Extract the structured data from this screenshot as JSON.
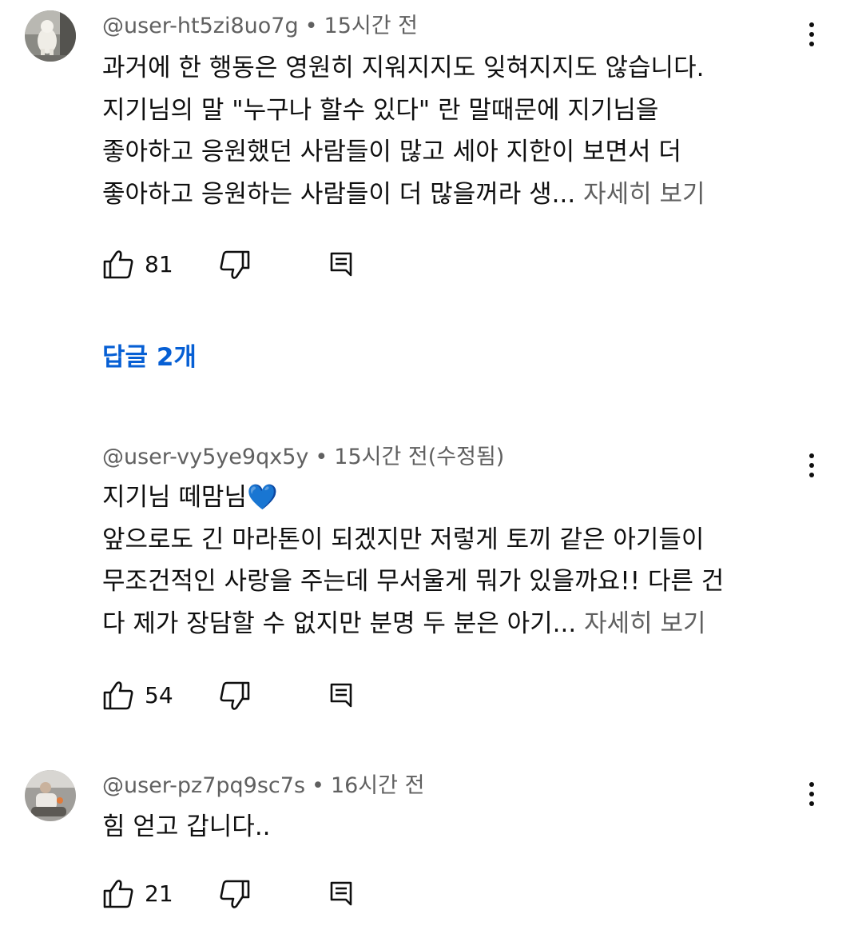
{
  "comments": [
    {
      "author": "@user-ht5zi8uo7g",
      "separator": "•",
      "time": "15시간 전",
      "lines": [
        "과거에 한 행동은 영원히 지워지지도 잊혀지지도 않습니다.",
        "지기님의 말 \"누구나 할수 있다\" 란 말때문에 지기님을",
        "좋아하고 응원했던 사람들이 많고 세아 지한이 보면서 더",
        "좋아하고 응원하는 사람들이 더 많을꺼라 생..."
      ],
      "more_label": "자세히 보기",
      "likes": "81",
      "replies_label": "답글 2개",
      "avatar": "dog-photo-avatar"
    },
    {
      "author": "@user-vy5ye9qx5y",
      "separator": "•",
      "time": "15시간 전(수정됨)",
      "lines": [
        "지기님 떼맘님💙",
        "앞으로도 긴 마라톤이 되겠지만 저렇게 토끼 같은 아기들이",
        "무조건적인 사랑을 주는데 무서울게 뭐가 있을까요!! 다른 건",
        "다 제가 장담할 수 없지만 분명 두 분은 아기..."
      ],
      "more_label": "자세히 보기",
      "likes": "54"
    },
    {
      "author": "@user-pz7pq9sc7s",
      "separator": "•",
      "time": "16시간 전",
      "lines": [
        "힘 얻고 갑니다.."
      ],
      "likes": "21",
      "avatar": "person-photo-avatar"
    }
  ],
  "icons": {
    "like": "thumbs-up-icon",
    "dislike": "thumbs-down-icon",
    "reply": "reply-comment-icon",
    "menu": "vertical-dots-icon"
  },
  "colors": {
    "text": "#0f0f0f",
    "secondary": "#606060",
    "link": "#065fd4",
    "heart": "#3ea6ff"
  }
}
